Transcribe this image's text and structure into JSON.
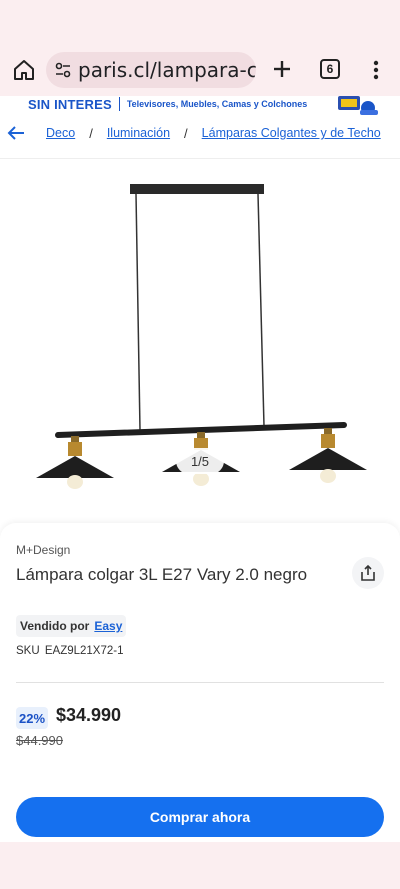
{
  "browser": {
    "url": "paris.cl/lampara-co",
    "tab_count": "6"
  },
  "promo": {
    "title": "SIN INTERES",
    "subtitle": "Televisores, Muebles, Camas y Colchones"
  },
  "breadcrumb": {
    "items": [
      "Deco",
      "Iluminación",
      "Lámparas Colgantes y de Techo"
    ],
    "separator": "/"
  },
  "gallery": {
    "counter": "1/5"
  },
  "product": {
    "brand": "M+Design",
    "title": "Lámpara colgar 3L E27 Vary 2.0 negro",
    "seller_label": "Vendido por",
    "seller_name": "Easy",
    "sku_label": "SKU",
    "sku_value": "EAZ9L21X72-1",
    "discount": "22%",
    "price": "$34.990",
    "old_price": "$44.990",
    "buy_label": "Comprar ahora"
  },
  "colors": {
    "accent": "#1570ef",
    "link": "#1b62d6",
    "browser_bg": "#fbeef0"
  }
}
